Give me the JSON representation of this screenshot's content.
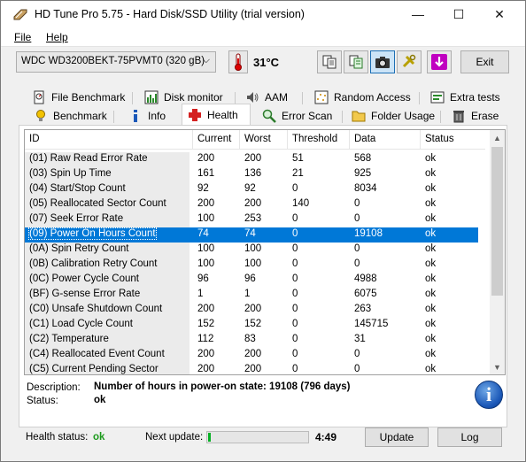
{
  "window": {
    "title": "HD Tune Pro 5.75 - Hard Disk/SSD Utility (trial version)",
    "controls": {
      "minimize": "—",
      "maximize": "☐",
      "close": "✕"
    }
  },
  "menu": {
    "file": "File",
    "help": "Help"
  },
  "toolbar": {
    "drive": "WDC WD3200BEKT-75PVMT0 (320 gB)",
    "temperature": "31°C",
    "exit_label": "Exit"
  },
  "tabs": {
    "row1": [
      "File Benchmark",
      "Disk monitor",
      "AAM",
      "Random Access",
      "Extra tests"
    ],
    "row2": [
      "Benchmark",
      "Info",
      "Health",
      "Error Scan",
      "Folder Usage",
      "Erase"
    ],
    "active": "Health"
  },
  "table": {
    "columns": [
      "ID",
      "Current",
      "Worst",
      "Threshold",
      "Data",
      "Status"
    ],
    "selected_index": 5,
    "rows": [
      {
        "id": "(01) Raw Read Error Rate",
        "current": "200",
        "worst": "200",
        "threshold": "51",
        "data": "568",
        "status": "ok"
      },
      {
        "id": "(03) Spin Up Time",
        "current": "161",
        "worst": "136",
        "threshold": "21",
        "data": "925",
        "status": "ok"
      },
      {
        "id": "(04) Start/Stop Count",
        "current": "92",
        "worst": "92",
        "threshold": "0",
        "data": "8034",
        "status": "ok"
      },
      {
        "id": "(05) Reallocated Sector Count",
        "current": "200",
        "worst": "200",
        "threshold": "140",
        "data": "0",
        "status": "ok"
      },
      {
        "id": "(07) Seek Error Rate",
        "current": "100",
        "worst": "253",
        "threshold": "0",
        "data": "0",
        "status": "ok"
      },
      {
        "id": "(09) Power On Hours Count",
        "current": "74",
        "worst": "74",
        "threshold": "0",
        "data": "19108",
        "status": "ok"
      },
      {
        "id": "(0A) Spin Retry Count",
        "current": "100",
        "worst": "100",
        "threshold": "0",
        "data": "0",
        "status": "ok"
      },
      {
        "id": "(0B) Calibration Retry Count",
        "current": "100",
        "worst": "100",
        "threshold": "0",
        "data": "0",
        "status": "ok"
      },
      {
        "id": "(0C) Power Cycle Count",
        "current": "96",
        "worst": "96",
        "threshold": "0",
        "data": "4988",
        "status": "ok"
      },
      {
        "id": "(BF) G-sense Error Rate",
        "current": "1",
        "worst": "1",
        "threshold": "0",
        "data": "6075",
        "status": "ok"
      },
      {
        "id": "(C0) Unsafe Shutdown Count",
        "current": "200",
        "worst": "200",
        "threshold": "0",
        "data": "263",
        "status": "ok"
      },
      {
        "id": "(C1) Load Cycle Count",
        "current": "152",
        "worst": "152",
        "threshold": "0",
        "data": "145715",
        "status": "ok"
      },
      {
        "id": "(C2) Temperature",
        "current": "112",
        "worst": "83",
        "threshold": "0",
        "data": "31",
        "status": "ok"
      },
      {
        "id": "(C4) Reallocated Event Count",
        "current": "200",
        "worst": "200",
        "threshold": "0",
        "data": "0",
        "status": "ok"
      },
      {
        "id": "(C5) Current Pending Sector",
        "current": "200",
        "worst": "200",
        "threshold": "0",
        "data": "0",
        "status": "ok"
      }
    ]
  },
  "details": {
    "description_label": "Description:",
    "description_value": "Number of hours in power-on state: 19108 (796 days)",
    "status_label": "Status:",
    "status_value": "ok"
  },
  "footer": {
    "health_label": "Health status:",
    "health_value": "ok",
    "next_update_label": "Next update:",
    "next_update_progress": 0.03,
    "next_update_time": "4:49",
    "update_label": "Update",
    "log_label": "Log"
  },
  "colors": {
    "selection": "#0078d7",
    "health_ok": "#1c9a1c",
    "progress": "#06b025"
  }
}
